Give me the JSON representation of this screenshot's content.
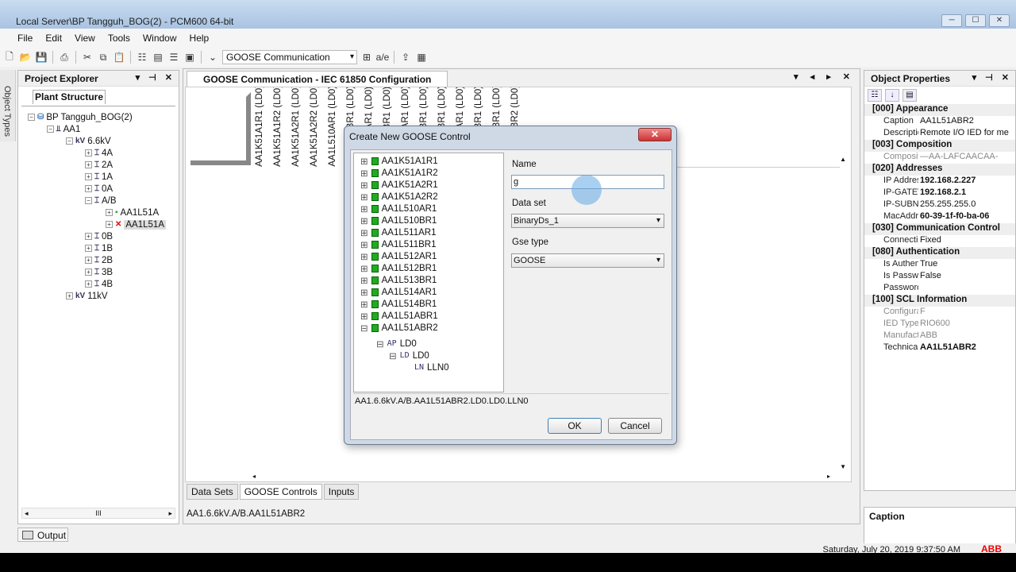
{
  "window": {
    "title": "Local Server\\BP Tangguh_BOG(2) - PCM600 64-bit",
    "controls": [
      "─",
      "☐",
      "✕"
    ]
  },
  "menu": [
    "File",
    "Edit",
    "View",
    "Tools",
    "Window",
    "Help"
  ],
  "toolbar": {
    "view_select": "GOOSE Communication"
  },
  "side_tab": "Object Types",
  "project_explorer": {
    "title": "Project Explorer",
    "controls": "▾ ⊣ ✕",
    "tab": "Plant Structure",
    "tree": [
      {
        "label": "BP Tangguh_BOG(2)",
        "icon": "database-icon"
      },
      {
        "label": "AA1",
        "icon": "substation-icon"
      },
      {
        "label": "6.6kV",
        "icon": "voltage-level-icon"
      },
      {
        "label": "4A",
        "icon": "bay-icon"
      },
      {
        "label": "2A",
        "icon": "bay-icon"
      },
      {
        "label": "1A",
        "icon": "bay-icon"
      },
      {
        "label": "0A",
        "icon": "bay-icon"
      },
      {
        "label": "A/B",
        "icon": "bay-icon"
      },
      {
        "label": "AA1L51A",
        "icon": "ied-icon"
      },
      {
        "label": "AA1L51A",
        "icon": "ied-icon"
      },
      {
        "label": "0B",
        "icon": "bay-icon"
      },
      {
        "label": "1B",
        "icon": "bay-icon"
      },
      {
        "label": "2B",
        "icon": "bay-icon"
      },
      {
        "label": "3B",
        "icon": "bay-icon"
      },
      {
        "label": "4B",
        "icon": "bay-icon"
      },
      {
        "label": "11kV",
        "icon": "voltage-level-icon"
      }
    ],
    "scroll_thumb": "III"
  },
  "document": {
    "tab": "GOOSE Communication - IEC 61850 Configuration",
    "controls": "▾ ◂ ▸ ✕",
    "columns": [
      "AA1K51A1R1 (LD0)",
      "AA1K51A1R2 (LD0)",
      "AA1K51A2R1 (LD0)",
      "AA1K51A2R2 (LD0)",
      "AA1L510AR1 (LD0)",
      "AA1L510BR1 (LD0)",
      "AA1L511AR1 (LD0)",
      "AA1L511BR1 (LD0)",
      "AA1L512AR1 (LD0)",
      "AA1L512BR1 (LD0)",
      "AA1L513BR1 (LD0)",
      "AA1L514AR1 (LD0)",
      "AA1L514BR1 (LD0)",
      "AA1L51ABR1 (LD0)",
      "AA1L51ABR2 (LD0)"
    ],
    "bottom_tabs": [
      "Data Sets",
      "GOOSE Controls",
      "Inputs"
    ],
    "status_path": "AA1.6.6kV.A/B.AA1L51ABR2"
  },
  "object_properties": {
    "title": "Object Properties",
    "controls": "▾ ⊣ ✕",
    "rows": [
      {
        "type": "cat",
        "label": "[000] Appearance"
      },
      {
        "type": "row",
        "k": "Caption",
        "v": "AA1L51ABR2"
      },
      {
        "type": "row",
        "k": "Description",
        "v": "Remote I/O IED for me"
      },
      {
        "type": "cat",
        "label": "[003] Composition"
      },
      {
        "type": "row",
        "k": "CompositionC",
        "v": "—AA-LAFCAACAA-",
        "grey": true
      },
      {
        "type": "cat",
        "label": "[020] Addresses"
      },
      {
        "type": "row",
        "k": "IP Address",
        "v": "192.168.2.227",
        "bold": true
      },
      {
        "type": "row",
        "k": "IP-GATEWAY",
        "v": "192.168.2.1",
        "bold": true
      },
      {
        "type": "row",
        "k": "IP-SUBNET",
        "v": "255.255.255.0"
      },
      {
        "type": "row",
        "k": "MacAddress",
        "v": "60-39-1f-f0-ba-06",
        "bold": true
      },
      {
        "type": "cat",
        "label": "[030] Communication Control"
      },
      {
        "type": "row",
        "k": "Connection Ty",
        "v": "Fixed"
      },
      {
        "type": "cat",
        "label": "[080] Authentication"
      },
      {
        "type": "row",
        "k": "Is Authenticati",
        "v": "True"
      },
      {
        "type": "row",
        "k": "Is Password u",
        "v": "False"
      },
      {
        "type": "row",
        "k": "Password",
        "v": ""
      },
      {
        "type": "cat",
        "label": "[100] SCL Information"
      },
      {
        "type": "row",
        "k": "Configuration",
        "v": "F",
        "grey": true
      },
      {
        "type": "row",
        "k": "IED Type",
        "v": "RIO600",
        "grey": true
      },
      {
        "type": "row",
        "k": "Manufacturer",
        "v": "ABB",
        "grey": true
      },
      {
        "type": "row",
        "k": "Technical Key",
        "v": "AA1L51ABR2",
        "bold": true
      }
    ],
    "caption_title": "Caption"
  },
  "output_tab": "Output",
  "status": {
    "datetime": "Saturday, July 20, 2019 9:37:50 AM",
    "brand": "ABB"
  },
  "dialog": {
    "title": "Create New GOOSE Control",
    "close": "✕",
    "tree": [
      {
        "label": "AA1K51A1R1",
        "depth": 0
      },
      {
        "label": "AA1K51A1R2",
        "depth": 0
      },
      {
        "label": "AA1K51A2R1",
        "depth": 0
      },
      {
        "label": "AA1K51A2R2",
        "depth": 0
      },
      {
        "label": "AA1L510AR1",
        "depth": 0
      },
      {
        "label": "AA1L510BR1",
        "depth": 0
      },
      {
        "label": "AA1L511AR1",
        "depth": 0
      },
      {
        "label": "AA1L511BR1",
        "depth": 0
      },
      {
        "label": "AA1L512AR1",
        "depth": 0
      },
      {
        "label": "AA1L512BR1",
        "depth": 0
      },
      {
        "label": "AA1L513BR1",
        "depth": 0
      },
      {
        "label": "AA1L514AR1",
        "depth": 0
      },
      {
        "label": "AA1L514BR1",
        "depth": 0
      },
      {
        "label": "AA1L51ABR1",
        "depth": 0
      },
      {
        "label": "AA1L51ABR2",
        "depth": 0
      }
    ],
    "sub_nodes": [
      {
        "prefix": "AP",
        "label": "LD0"
      },
      {
        "prefix": "LD",
        "label": "LD0"
      },
      {
        "prefix": "LN",
        "label": "LLN0"
      }
    ],
    "name_label": "Name",
    "name_value": "g",
    "dataset_label": "Data set",
    "dataset_value": "BinaryDs_1",
    "gse_label": "Gse type",
    "gse_value": "GOOSE",
    "path": "AA1.6.6kV.A/B.AA1L51ABR2.LD0.LD0.LLN0",
    "ok": "OK",
    "cancel": "Cancel"
  }
}
